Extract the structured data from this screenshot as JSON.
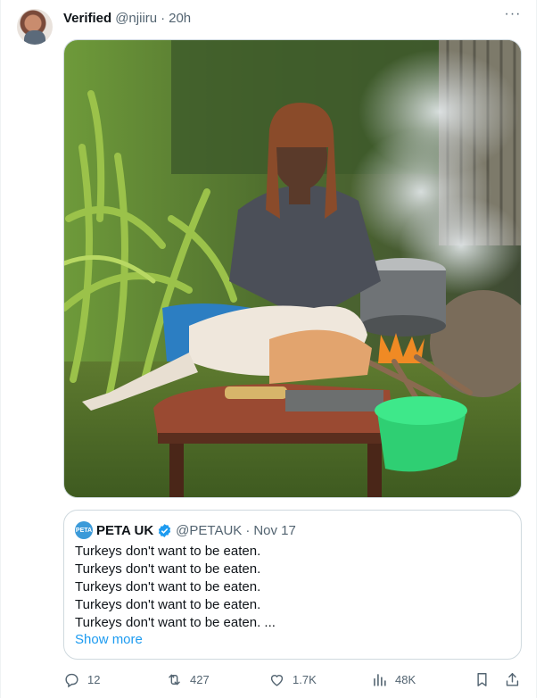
{
  "post": {
    "display_name": "Verified",
    "handle": "@njiiru",
    "separator": "·",
    "time": "20h",
    "more": "···"
  },
  "quote": {
    "avatar_text": "PETA",
    "name": "PETA UK",
    "handle": "@PETAUK",
    "separator": "·",
    "time": "Nov 17",
    "lines": [
      "Turkeys don't want to be eaten.",
      "Turkeys don't want to be eaten.",
      "Turkeys don't want to be eaten.",
      "Turkeys don't want to be eaten.",
      "Turkeys don't want to be eaten. ..."
    ],
    "show_more": "Show more"
  },
  "actions": {
    "replies": "12",
    "reposts": "427",
    "likes": "1.7K",
    "views": "48K"
  },
  "icons": [
    "reply-icon",
    "repost-icon",
    "like-icon",
    "views-icon",
    "bookmark-icon",
    "share-icon",
    "verified-badge-icon"
  ],
  "colors": {
    "accent": "#1d9bf0",
    "secondary_text": "#536471",
    "border": "#cfd9de"
  }
}
